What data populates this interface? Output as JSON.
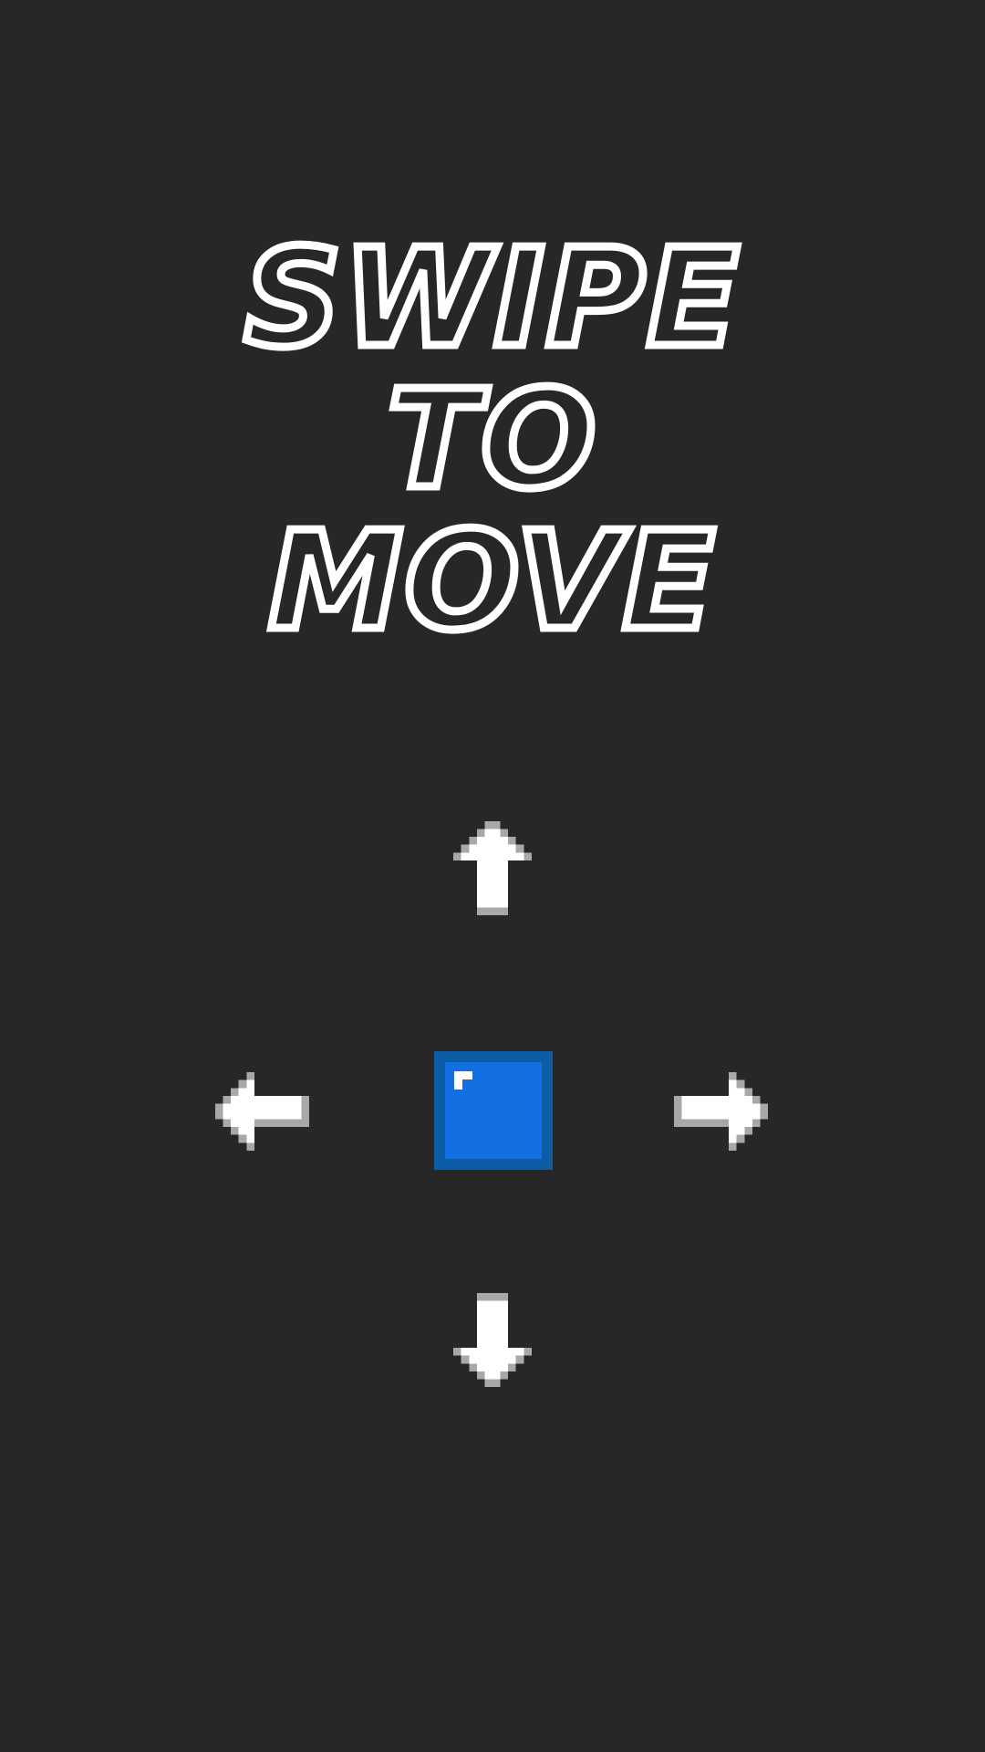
{
  "title": {
    "line1": "SWIPE",
    "line2": "TO",
    "line3": "MOVE"
  },
  "controls": {
    "up": "arrow-up-icon",
    "down": "arrow-down-icon",
    "left": "arrow-left-icon",
    "right": "arrow-right-icon"
  },
  "player": {
    "color": "#1270e3",
    "border_color": "#0d5da6",
    "highlight_color": "#ffffff"
  },
  "colors": {
    "background": "#272727",
    "foreground": "#ffffff",
    "arrow_shadow": "#a8a8a8"
  }
}
